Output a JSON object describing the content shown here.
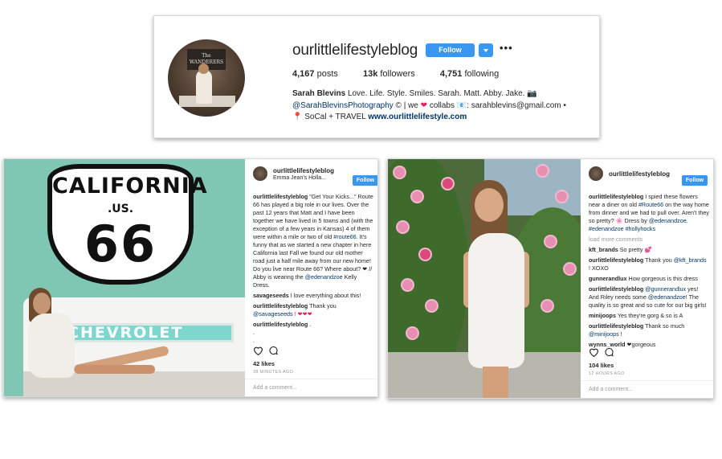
{
  "profile": {
    "username": "ourlittlelifestyleblog",
    "follow_label": "Follow",
    "more_label": "•••",
    "posts_count": "4,167",
    "posts_label": "posts",
    "followers_count": "13k",
    "followers_label": "followers",
    "following_count": "4,751",
    "following_label": "following",
    "bio_name": "Sarah Blevins",
    "bio_line1": "Love. Life. Style. Smiles. Sarah. Matt. Abby. Jake. 📷",
    "bio_handle": "@SarahBlevinsPhotography",
    "bio_line2_mid": " © | we ",
    "bio_heart": "❤",
    "bio_line2_end": " collabs 📧: sarahblevins@gmail.com •",
    "bio_line3": "📍 SoCal + TRAVEL ",
    "bio_website": "www.ourlittlelifestyle.com",
    "avatar_sign": "The WANDERERS"
  },
  "post1": {
    "username": "ourlittlelifestyleblog",
    "location": "Emma Jean's Holla...",
    "follow_label": "Follow",
    "sign_title": "CALIFORNIA",
    "sign_us": ".US.",
    "sign_number": "66",
    "bench_text": "CHEVROLET",
    "caption_user": "ourlittlelifestyleblog",
    "caption_a": " \"Get Your Kicks...\" Route 66 has played a big role in our lives. Over the past 12 years that Matt and I have been together we have lived in 5 towns and (with the exception of a few years in Kansas) 4 of them were within a mile or two of old ",
    "caption_tag1": "#route66",
    "caption_b": ". It's funny that as we started a new chapter in here California last Fall we found our old mother road just a half mile away from our new home! Do you live near Route 66? Where about? ❤ // Abby is wearing the ",
    "caption_tag2": "@edenandzoe",
    "caption_c": " Kelly Dress.",
    "c1_user": "savageseeds",
    "c1_text": " I love everything about this!",
    "c2_user": "ourlittlelifestyleblog",
    "c2_text": " Thank you ",
    "c2_tag": "@savageseeds",
    "c2_end": " ! ❤❤❤",
    "c3_user": "ourlittlelifestyleblog",
    "c3_text": " .",
    "c3_dots": ".\n.",
    "likes": "42 likes",
    "time": "38 MINUTES AGO",
    "add_comment": "Add a comment..."
  },
  "post2": {
    "username": "ourlittlelifestyleblog",
    "follow_label": "Follow",
    "caption_user": "ourlittlelifestyleblog",
    "caption_a": " I spied these flowers near a diner on old ",
    "caption_tag1": "#Route66",
    "caption_b": " on the way home from dinner and we had to pull over. Aren't they so pretty? 🌸 Dress by ",
    "caption_tag2": "@edenandzoe. #edenandzoe #hollyhocks",
    "load_more": "load more comments",
    "c1_user": "kft_brands",
    "c1_text": " So pretty 💕",
    "c2_user": "ourlittlelifestyleblog",
    "c2_text": " Thank you ",
    "c2_tag": "@kft_brands",
    "c2_end": " ! XOXO",
    "c3_user": "gunnerandlux",
    "c3_text": " How gorgeous is this dress",
    "c4_user": "ourlittlelifestyleblog",
    "c4_text": " ",
    "c4_tag": "@gunnerandlux",
    "c4_mid": " yes! And Riley needs some ",
    "c4_tag2": "@edenandzoe",
    "c4_end": "! The quality is so great and so cute for our big girls!",
    "c5_user": "minijoops",
    "c5_text": " Yes they're gorg & so is A",
    "c6_user": "ourlittlelifestyleblog",
    "c6_text": " Thank so much ",
    "c6_tag": "@minijoops",
    "c6_end": " !",
    "c7_user": "wynns_world",
    "c7_text": " ❤gorgeous",
    "likes": "104 likes",
    "time": "12 HOURS AGO",
    "add_comment": "Add a comment..."
  },
  "colors": {
    "follow_blue": "#3897f0",
    "link_blue": "#003569",
    "heart_red": "#e0245e"
  }
}
